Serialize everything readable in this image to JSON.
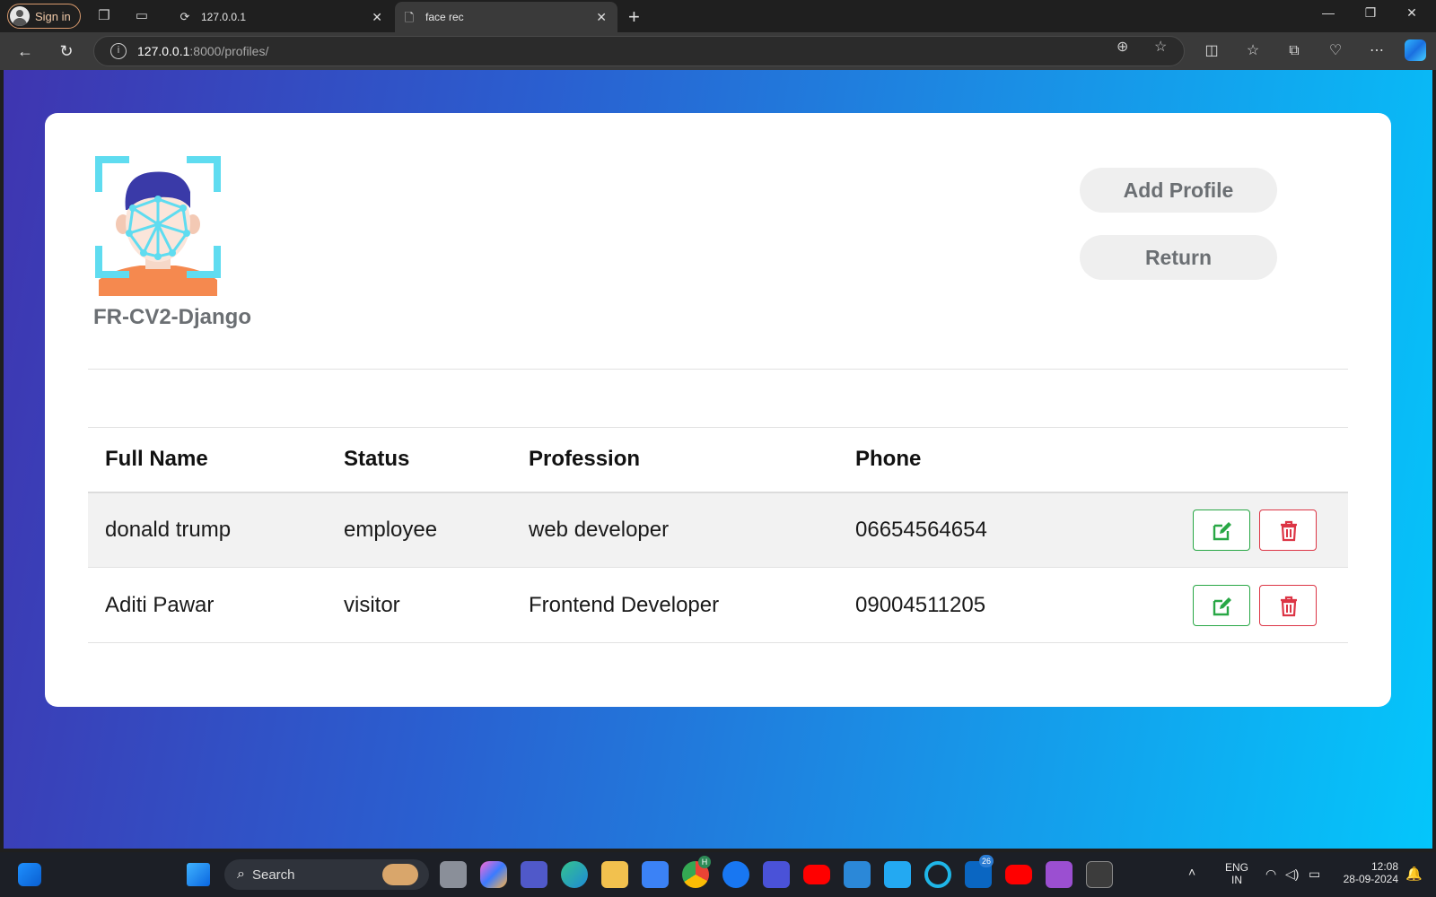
{
  "browser": {
    "signin_label": "Sign in",
    "tabs": [
      {
        "title": "127.0.0.1",
        "icon": "page-loading-icon"
      },
      {
        "title": "face rec",
        "icon": "document-icon",
        "active": true
      }
    ],
    "url_host": "127.0.0.1",
    "url_path": ":8000/profiles/"
  },
  "page": {
    "brand": "FR-CV2-Django",
    "buttons": {
      "add_profile": "Add Profile",
      "return": "Return"
    },
    "table": {
      "headers": [
        "Full Name",
        "Status",
        "Profession",
        "Phone"
      ],
      "rows": [
        {
          "name": "donald trump",
          "status": "employee",
          "profession": "web developer",
          "phone": "06654564654"
        },
        {
          "name": "Aditi Pawar",
          "status": "visitor",
          "profession": "Frontend Developer",
          "phone": "09004511205"
        }
      ]
    }
  },
  "taskbar": {
    "search_label": "Search",
    "language": "ENG",
    "region": "IN",
    "time": "12:08",
    "date": "28-09-2024",
    "chrome_badge": "H",
    "linkedin_badge": "26"
  },
  "colors": {
    "gradient_start": "#3f35b0",
    "gradient_end": "#04c6fb",
    "edit_green": "#28a745",
    "delete_red": "#dc3545",
    "brand_gray": "#6b6f73"
  }
}
